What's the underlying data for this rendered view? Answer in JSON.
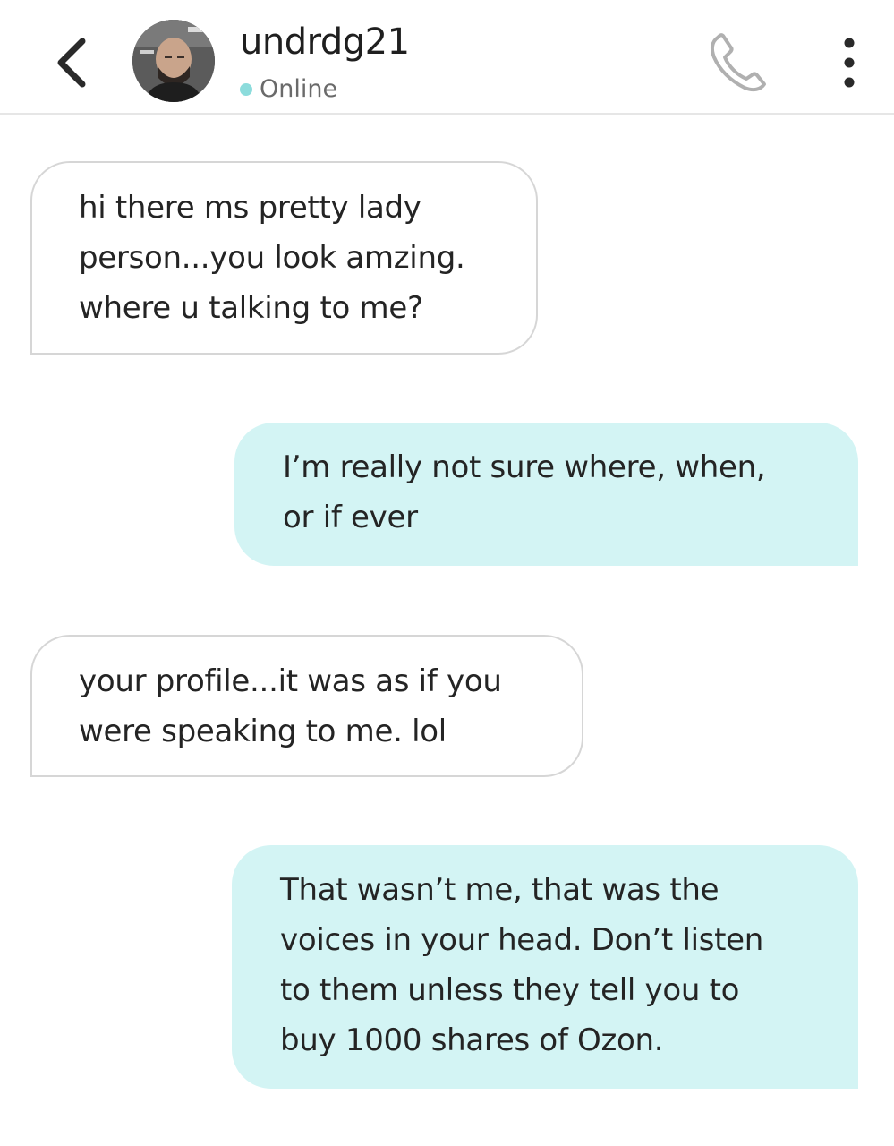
{
  "colors": {
    "outgoing_bubble": "#d3f4f4",
    "incoming_border": "#d6d6d6",
    "online_dot": "#8cdcdc",
    "icon_gray": "#b0b0b0",
    "icon_dark": "#2a2a2a"
  },
  "header": {
    "back_icon": "chevron-left-icon",
    "avatar_icon": "user-photo",
    "username": "undrdg21",
    "status": "Online",
    "call_icon": "phone-icon",
    "menu_icon": "more-vertical-icon"
  },
  "messages": [
    {
      "direction": "incoming",
      "text": "hi there ms pretty lady\nperson...you look amzing.\nwhere u talking to me?"
    },
    {
      "direction": "outgoing",
      "text": "I’m really not sure where, when,\nor if ever"
    },
    {
      "direction": "incoming",
      "text": "your profile...it was as if you\nwere speaking to me. lol"
    },
    {
      "direction": "outgoing",
      "text": "That wasn’t me, that was the\nvoices in your head. Don’t listen\nto them unless they tell you to\nbuy 1000 shares of Ozon."
    }
  ]
}
